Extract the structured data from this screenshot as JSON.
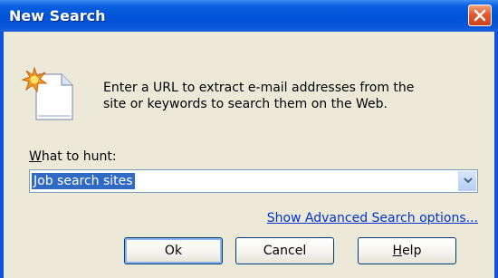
{
  "window": {
    "title": "New Search"
  },
  "description": {
    "line1": "Enter a URL to extract e-mail addresses from the",
    "line2": "site or keywords to search them on the Web."
  },
  "field": {
    "label_accel": "W",
    "label_rest": "hat to hunt:",
    "value": "Job search sites"
  },
  "advanced_link": "Show Advanced Search options...",
  "buttons": {
    "ok": "Ok",
    "cancel": "Cancel",
    "help_accel": "H",
    "help_rest": "elp"
  },
  "colors": {
    "titlebar": "#0052d6",
    "selection": "#316ac5",
    "link": "#0033cc",
    "dialog_bg": "#ece9d8"
  },
  "icons": [
    "close-icon",
    "new-document-icon",
    "dropdown-arrow-icon"
  ]
}
